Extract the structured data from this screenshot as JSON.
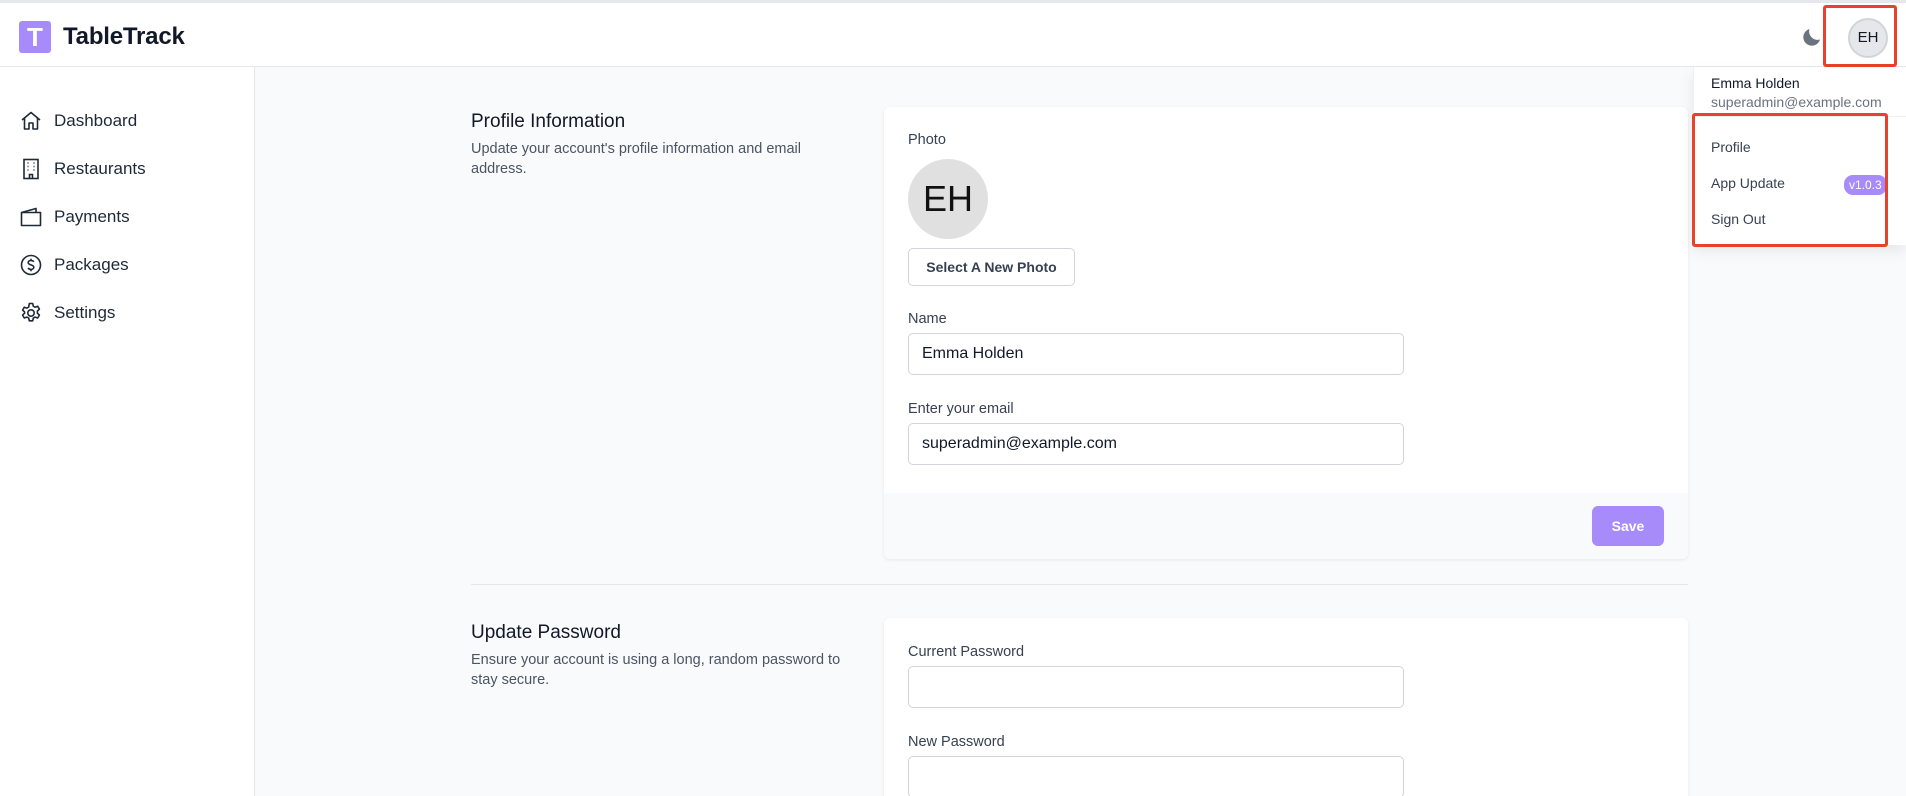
{
  "header": {
    "logo_letter": "T",
    "app_name": "TableTrack",
    "user_initials": "EH"
  },
  "sidebar": {
    "items": [
      {
        "label": "Dashboard",
        "icon": "home-icon"
      },
      {
        "label": "Restaurants",
        "icon": "building-icon"
      },
      {
        "label": "Payments",
        "icon": "wallet-icon"
      },
      {
        "label": "Packages",
        "icon": "dollar-circle-icon"
      },
      {
        "label": "Settings",
        "icon": "gear-icon"
      }
    ]
  },
  "profile_info": {
    "title": "Profile Information",
    "description": "Update your account's profile information and email address.",
    "photo_label": "Photo",
    "photo_initials": "EH",
    "select_photo_label": "Select A New Photo",
    "name_label": "Name",
    "name_value": "Emma Holden",
    "email_label": "Enter your email",
    "email_value": "superadmin@example.com",
    "save_label": "Save"
  },
  "update_password": {
    "title": "Update Password",
    "description": "Ensure your account is using a long, random password to stay secure.",
    "current_label": "Current Password",
    "new_label": "New Password"
  },
  "user_menu": {
    "name": "Emma Holden",
    "email": "superadmin@example.com",
    "items": [
      {
        "label": "Profile"
      },
      {
        "label": "App Update",
        "badge": "v1.0.3"
      },
      {
        "label": "Sign Out"
      }
    ]
  },
  "colors": {
    "accent": "#a78bfa",
    "highlight": "#e8412c"
  }
}
